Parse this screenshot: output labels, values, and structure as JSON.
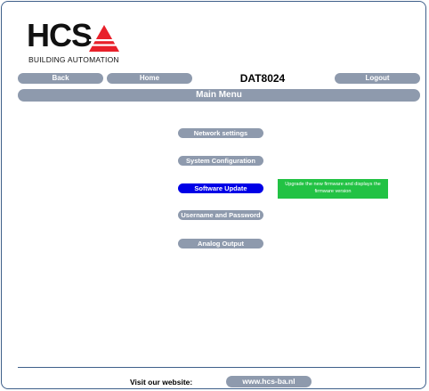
{
  "brand": {
    "logo_text": "HCS",
    "logo_subtitle": "BUILDING AUTOMATION",
    "accent_color": "#e8202a"
  },
  "nav": {
    "back_label": "Back",
    "home_label": "Home",
    "device_name": "DAT8024",
    "logout_label": "Logout"
  },
  "page": {
    "title": "Main Menu"
  },
  "menu": {
    "items": [
      {
        "label": "Network settings"
      },
      {
        "label": "System Configuration"
      },
      {
        "label": "Software Update"
      },
      {
        "label": "Username and Password"
      },
      {
        "label": "Analog Output"
      }
    ],
    "active_item": "Software Update",
    "tooltip": "Upgrade the new firmware and displays the firmware version"
  },
  "footer": {
    "visit_label": "Visit our website:",
    "website": "www.hcs-ba.nl"
  },
  "colors": {
    "button": "#8e9aad",
    "active_button": "#0000e6",
    "tooltip": "#22c244",
    "frame_border": "#3e5f8a"
  }
}
